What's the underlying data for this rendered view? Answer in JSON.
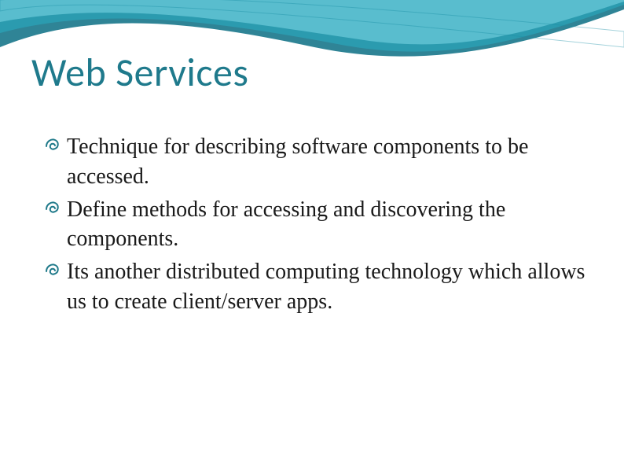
{
  "title": "Web Services",
  "bullets": [
    "Technique for describing software components to be accessed.",
    "Define methods for accessing and discovering the components.",
    "Its another distributed computing technology which allows us to create client/server apps."
  ],
  "colors": {
    "title": "#1f7a8c",
    "bullet_stroke": "#207a8a",
    "wave_outer": "#0b6e84",
    "wave_inner": "#55c7dd"
  }
}
